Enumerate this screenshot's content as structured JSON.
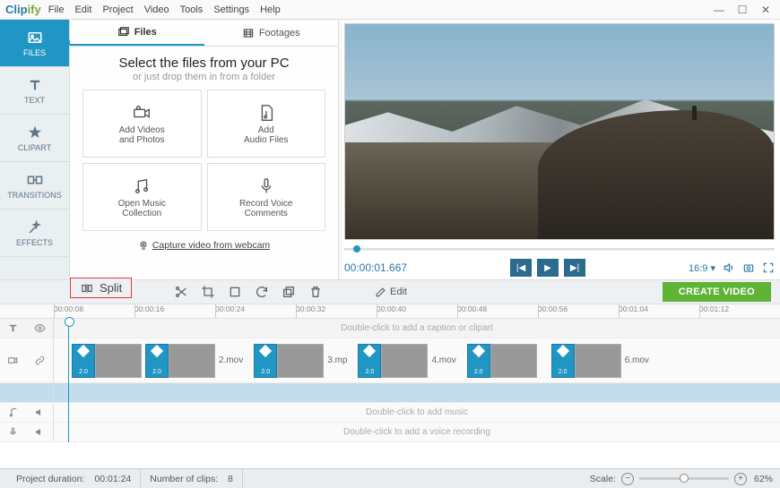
{
  "app": {
    "name_a": "Clip",
    "name_b": "ify"
  },
  "menu": [
    "File",
    "Edit",
    "Project",
    "Video",
    "Tools",
    "Settings",
    "Help"
  ],
  "sidebar": [
    {
      "label": "FILES"
    },
    {
      "label": "TEXT"
    },
    {
      "label": "CLIPART"
    },
    {
      "label": "TRANSITIONS"
    },
    {
      "label": "EFFECTS"
    }
  ],
  "panel": {
    "tab_files": "Files",
    "tab_footages": "Footages",
    "heading": "Select the files from your PC",
    "sub": "or just drop them in from a folder",
    "tiles": [
      {
        "l1": "Add Videos",
        "l2": "and Photos"
      },
      {
        "l1": "Add",
        "l2": "Audio Files"
      },
      {
        "l1": "Open Music",
        "l2": "Collection"
      },
      {
        "l1": "Record Voice",
        "l2": "Comments"
      }
    ],
    "webcam": "Capture video from webcam"
  },
  "preview": {
    "timecode": "00:00:01.667",
    "aspect": "16:9"
  },
  "toolbar": {
    "split": "Split",
    "edit": "Edit",
    "create": "CREATE VIDEO"
  },
  "ruler": [
    "00:00:08",
    "00:00:16",
    "00:00:24",
    "00:00:32",
    "00:00:40",
    "00:00:48",
    "00:00:56",
    "00:01:04",
    "00:01:12"
  ],
  "timeline": {
    "caption_placeholder": "Double-click to add a caption or clipart",
    "clip_duration": "2.0",
    "clips": [
      "2.mov",
      "3.mp",
      "4.mov",
      "",
      "6.mov"
    ],
    "music_placeholder": "Double-click to add music",
    "voice_placeholder": "Double-click to add a voice recording"
  },
  "status": {
    "duration_label": "Project duration:",
    "duration_value": "00:01:24",
    "clips_label": "Number of clips:",
    "clips_value": "8",
    "scale_label": "Scale:",
    "zoom": "62%"
  }
}
